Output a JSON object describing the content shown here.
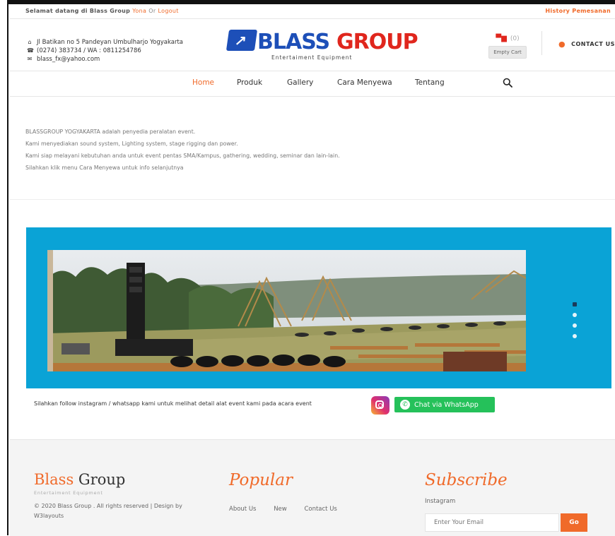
{
  "topbar": {
    "welcome": "Selamat datang di Blass Group",
    "user_link": "Yona",
    "or_text": "Or",
    "logout_link": "Logout",
    "history": "History Pemesanan"
  },
  "header": {
    "address": "Jl Batikan no 5 Pandeyan Umbulharjo Yogyakarta",
    "phone": "(0274) 383734 / WA : 0811254786",
    "email": "blass_fx@yahoo.com",
    "logo_part1": "BLASS",
    "logo_part2": "GROUP",
    "logo_tagline": "Entertaiment Equipment",
    "cart_count": "(0)",
    "empty_cart": "Empty Cart",
    "contact_us": "CONTACT US"
  },
  "nav": {
    "items": [
      "Home",
      "Produk",
      "Gallery",
      "Cara Menyewa",
      "Tentang"
    ],
    "active_index": 0
  },
  "intro": {
    "lines": [
      "BLASSGROUP YOGYAKARTA adalah penyedia peralatan event.",
      "Kami menyediakan sound system, Lighting system, stage rigging dan power.",
      "Kami siap melayani kebutuhan anda untuk event pentas SMA/Kampus, gathering, wedding, seminar dan lain-lain.",
      "Silahkan klik menu Cara Menyewa untuk info selanjutnya"
    ]
  },
  "slider": {
    "dot_count": 4,
    "active_dot": 0,
    "accent": "#0aa3d6"
  },
  "follow": {
    "text": "Silahkan follow instagram / whatsapp kami untuk melihat detail alat event kami pada acara event",
    "whatsapp_label": "Chat via WhatsApp"
  },
  "footer": {
    "brand_a": "Blass",
    "brand_b": "Group",
    "brand_sub": "Entertaiment Equipment",
    "copyright_line1": "© 2020 Blass Group . All rights reserved | Design by",
    "copyright_line2": "W3layouts",
    "popular_heading": "Popular",
    "popular_links": [
      "About Us",
      "New",
      "Contact Us"
    ],
    "subscribe_heading": "Subscribe",
    "instagram_label": "Instagram",
    "email_placeholder": "Enter Your Email",
    "go_label": "Go"
  },
  "colors": {
    "brand_orange": "#f06a2a",
    "brand_blue": "#1d4fb8",
    "brand_red": "#e0261d",
    "whatsapp_green": "#25c15a"
  }
}
